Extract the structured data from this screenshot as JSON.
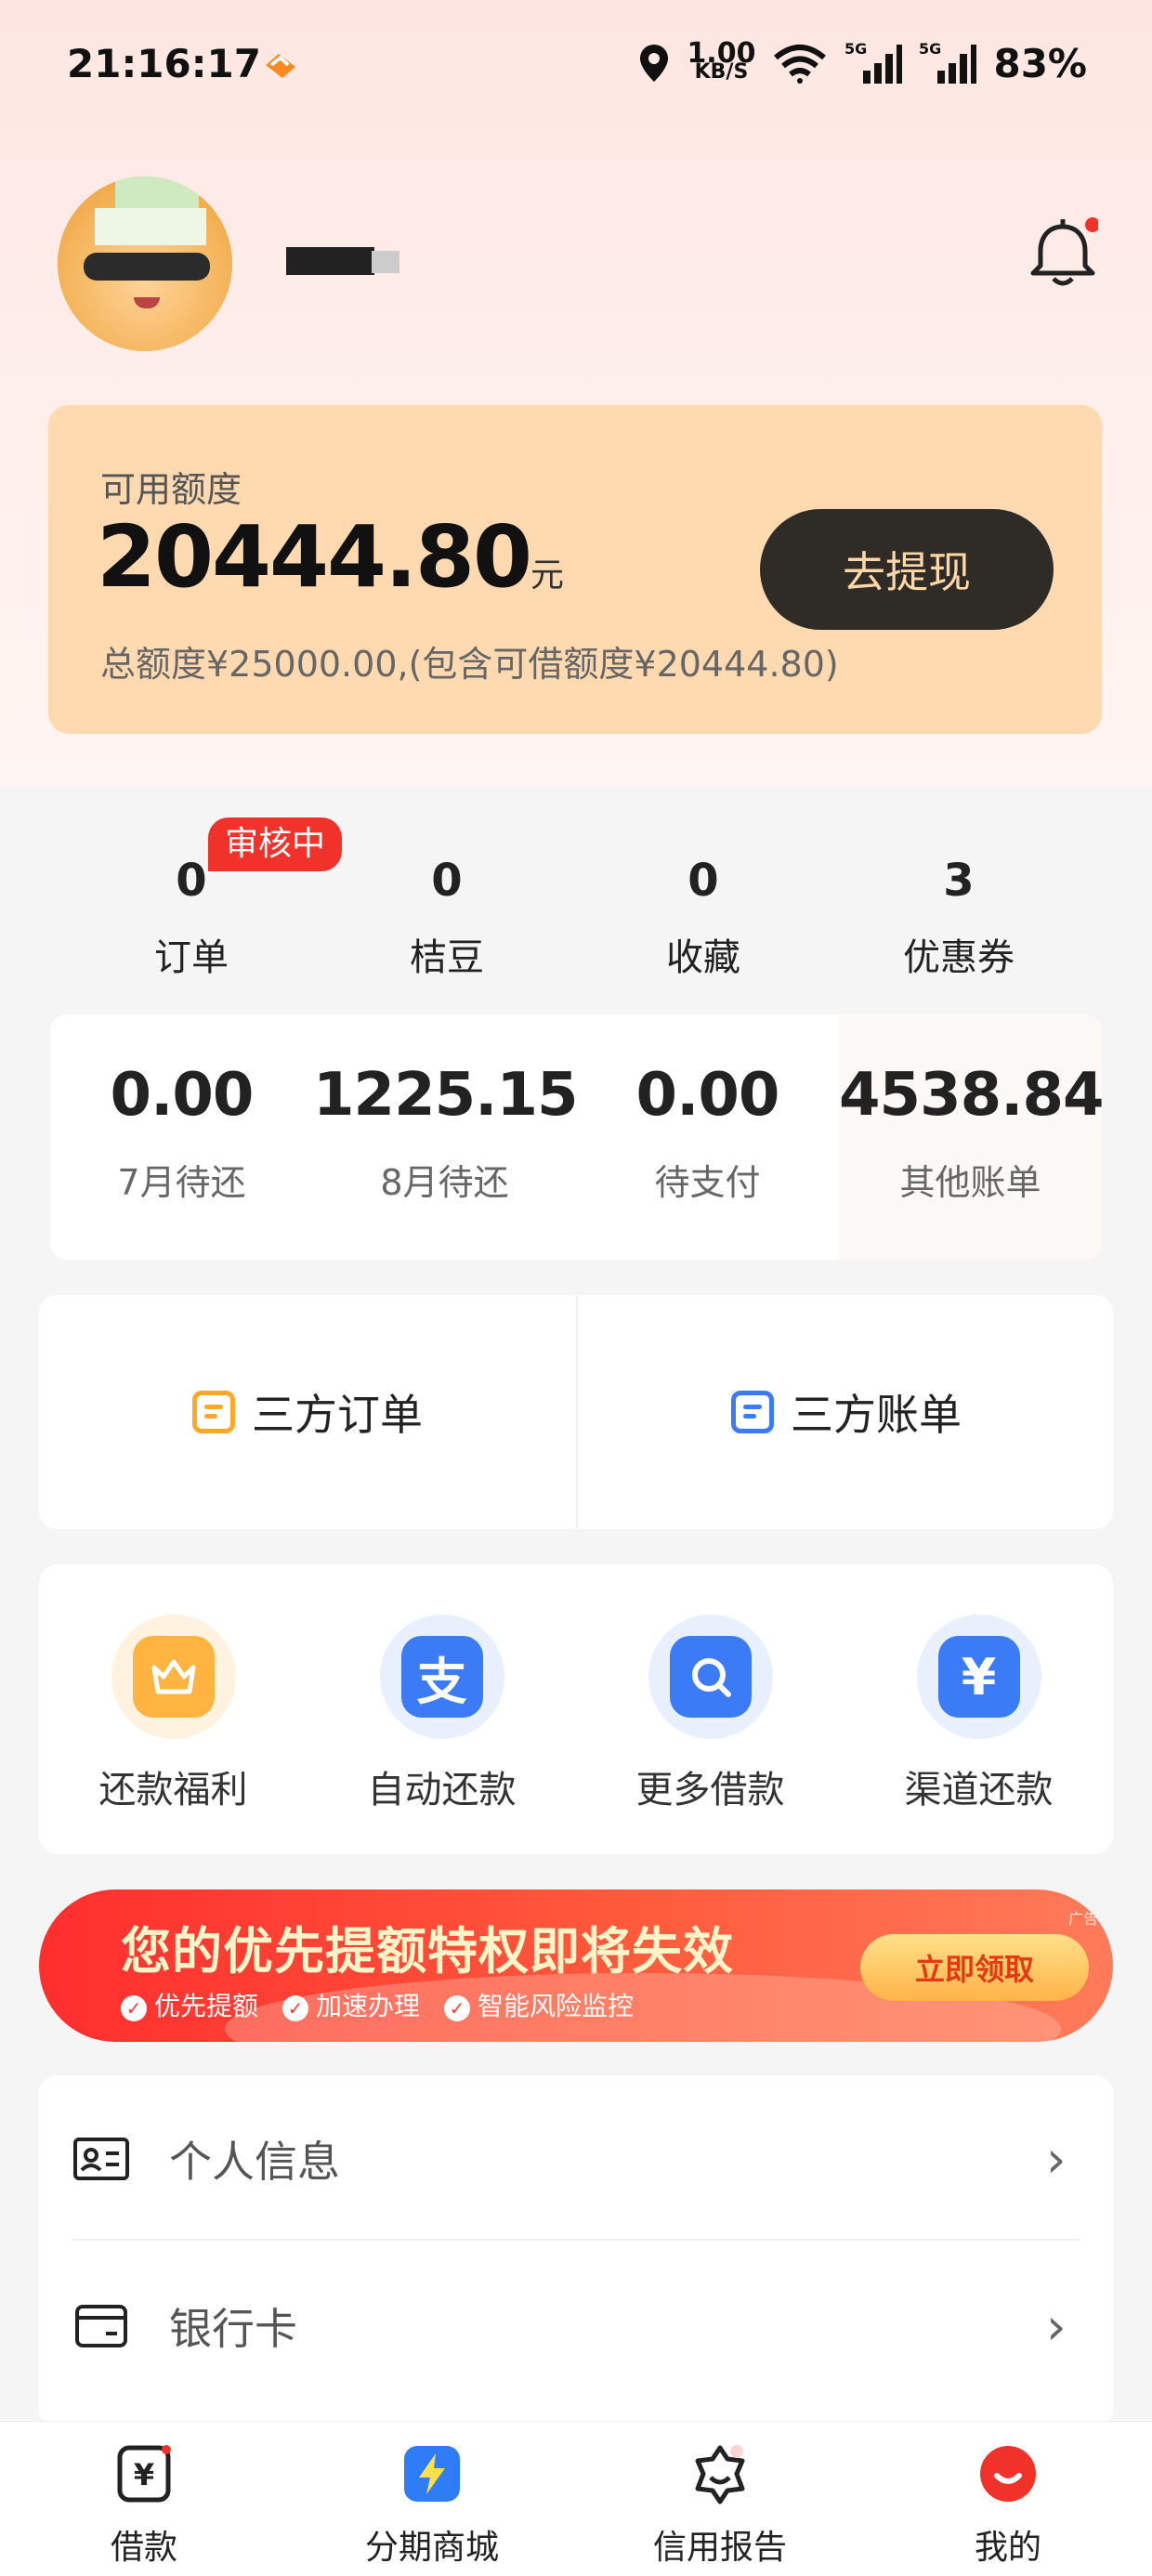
{
  "status_bar": {
    "time": "21:16:17",
    "net_speed_value": "1.00",
    "net_speed_unit": "KB/S",
    "battery": "83%"
  },
  "profile": {
    "notification_dot": true
  },
  "credit": {
    "label": "可用额度",
    "amount": "20444.80",
    "unit": "元",
    "withdraw_button": "去提现",
    "summary": "总额度¥25000.00,(包含可借额度¥20444.80)"
  },
  "stats": {
    "review_badge": "审核中",
    "items": [
      {
        "value": "0",
        "label": "订单"
      },
      {
        "value": "0",
        "label": "桔豆"
      },
      {
        "value": "0",
        "label": "收藏"
      },
      {
        "value": "3",
        "label": "优惠券"
      }
    ]
  },
  "bills": [
    {
      "value": "0.00",
      "label": "7月待还"
    },
    {
      "value": "1225.15",
      "label": "8月待还"
    },
    {
      "value": "0.00",
      "label": "待支付"
    },
    {
      "value": "4538.84",
      "label": "其他账单"
    }
  ],
  "third_party": {
    "orders": "三方订单",
    "bills": "三方账单"
  },
  "quick_actions": [
    {
      "label": "还款福利",
      "icon": "gift-icon",
      "color": "#ffb340"
    },
    {
      "label": "自动还款",
      "icon": "alipay-icon",
      "color": "#3b7cf6"
    },
    {
      "label": "更多借款",
      "icon": "search-icon",
      "color": "#3b7cf6"
    },
    {
      "label": "渠道还款",
      "icon": "yen-icon",
      "color": "#3b7cf6"
    }
  ],
  "banner": {
    "title": "您的优先提额特权即将失效",
    "tags": [
      "优先提额",
      "加速办理",
      "智能风险监控"
    ],
    "button": "立即领取",
    "ad_label": "广告"
  },
  "menu": [
    {
      "label": "个人信息",
      "icon": "id-card-icon"
    },
    {
      "label": "银行卡",
      "icon": "bank-card-icon"
    }
  ],
  "tabbar": [
    {
      "label": "借款",
      "icon": "loan-icon"
    },
    {
      "label": "分期商城",
      "icon": "mall-icon"
    },
    {
      "label": "信用报告",
      "icon": "credit-report-icon"
    },
    {
      "label": "我的",
      "icon": "mine-icon"
    }
  ]
}
